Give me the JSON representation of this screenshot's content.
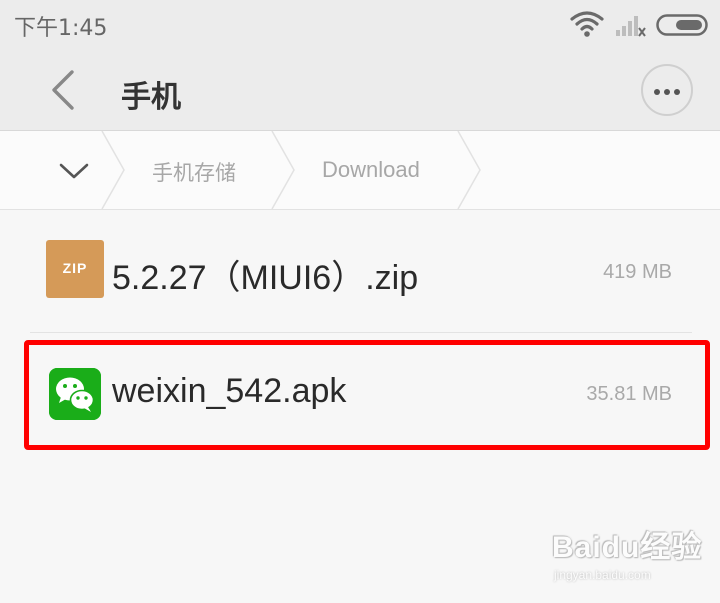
{
  "status_bar": {
    "time": "下午1:45",
    "icons": [
      "wifi-icon",
      "signal-no-sim-icon",
      "battery-icon"
    ]
  },
  "header": {
    "title": "手机",
    "back_icon": "chevron-left-icon",
    "menu_icon": "more-horizontal-icon"
  },
  "breadcrumb": {
    "toggle_icon": "chevron-down-icon",
    "items": [
      "手机存储",
      "Download"
    ]
  },
  "files": [
    {
      "name": "5.2.27（MIUI6）.zip",
      "size": "419 MB",
      "icon": "zip-file-icon",
      "icon_label": "ZIP",
      "icon_color": "#d59a58"
    },
    {
      "name": "weixin_542.apk",
      "size": "35.81 MB",
      "icon": "wechat-app-icon",
      "icon_color": "#1aad19",
      "highlighted": true
    }
  ],
  "highlight_color": "#ff0000",
  "watermark": {
    "logo": "Baidu经验",
    "url": "jingyan.baidu.com"
  }
}
